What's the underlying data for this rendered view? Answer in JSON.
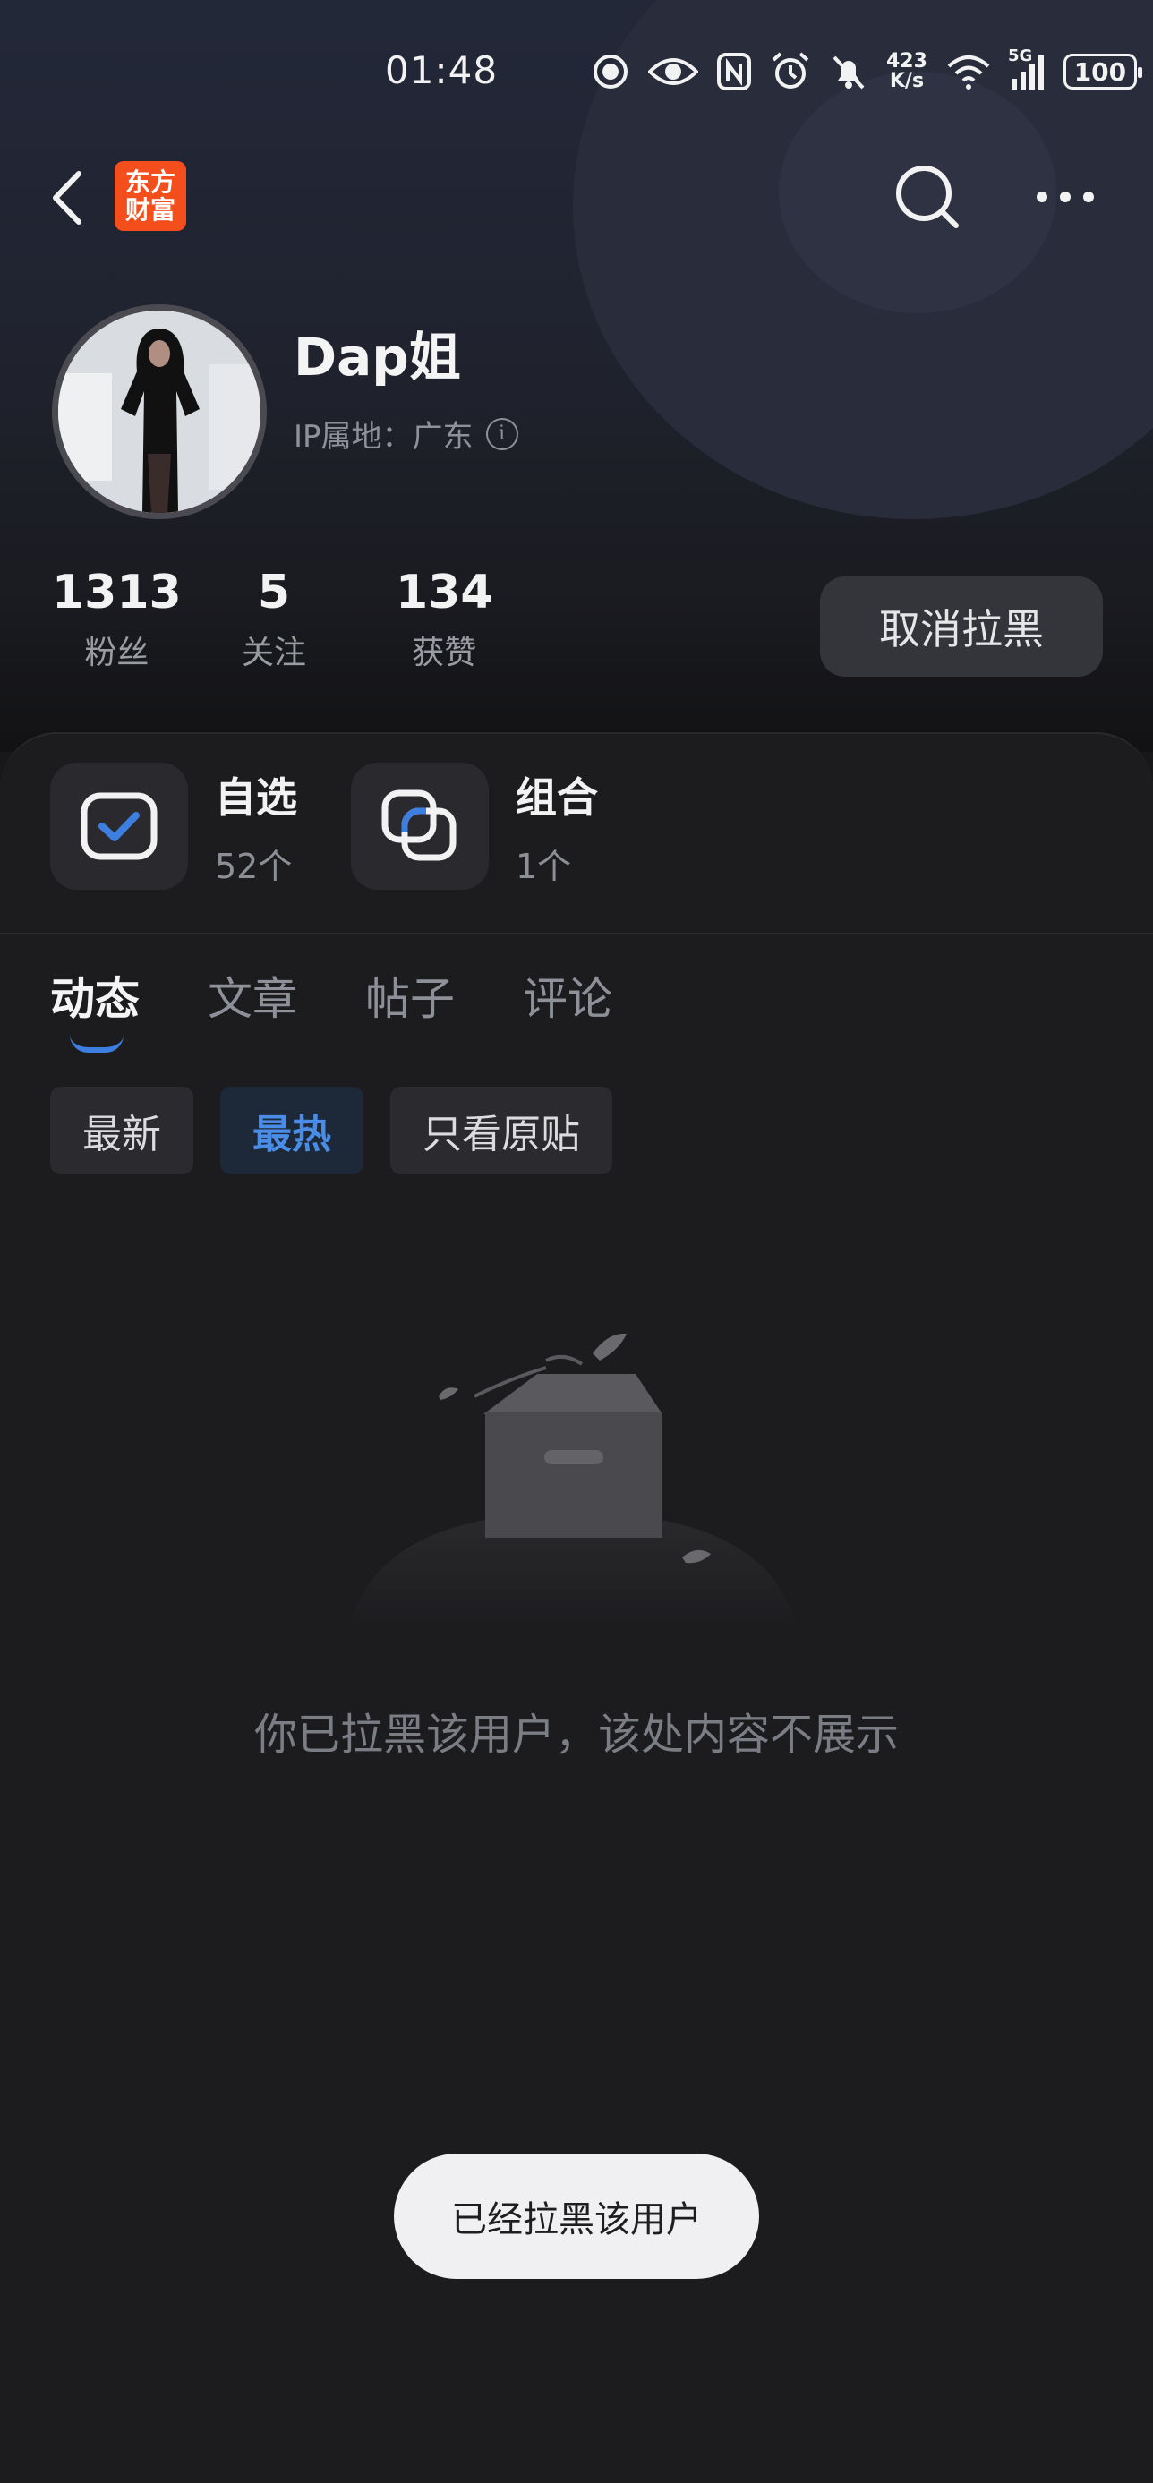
{
  "status_bar": {
    "time": "01:48",
    "net_speed_value": "423",
    "net_speed_unit": "K/s",
    "network": "5G",
    "battery": "100"
  },
  "app": {
    "logo_line1": "东方",
    "logo_line2": "财富"
  },
  "profile": {
    "name": "Dap姐",
    "ip_location": "IP属地：广东",
    "stats": [
      {
        "value": "1313",
        "label": "粉丝"
      },
      {
        "value": "5",
        "label": "关注"
      },
      {
        "value": "134",
        "label": "获赞"
      }
    ],
    "unblock_label": "取消拉黑"
  },
  "quick_cards": [
    {
      "title": "自选",
      "count": "52个"
    },
    {
      "title": "组合",
      "count": "1个"
    }
  ],
  "tabs": [
    "动态",
    "文章",
    "帖子",
    "评论"
  ],
  "active_tab": "动态",
  "filters": [
    "最新",
    "最热",
    "只看原贴"
  ],
  "active_filter": "最热",
  "empty_message": "你已拉黑该用户，该处内容不展示",
  "toast": "已经拉黑该用户",
  "colors": {
    "accent": "#3d7fe0",
    "logo": "#f34e1b",
    "background": "#18181b"
  }
}
